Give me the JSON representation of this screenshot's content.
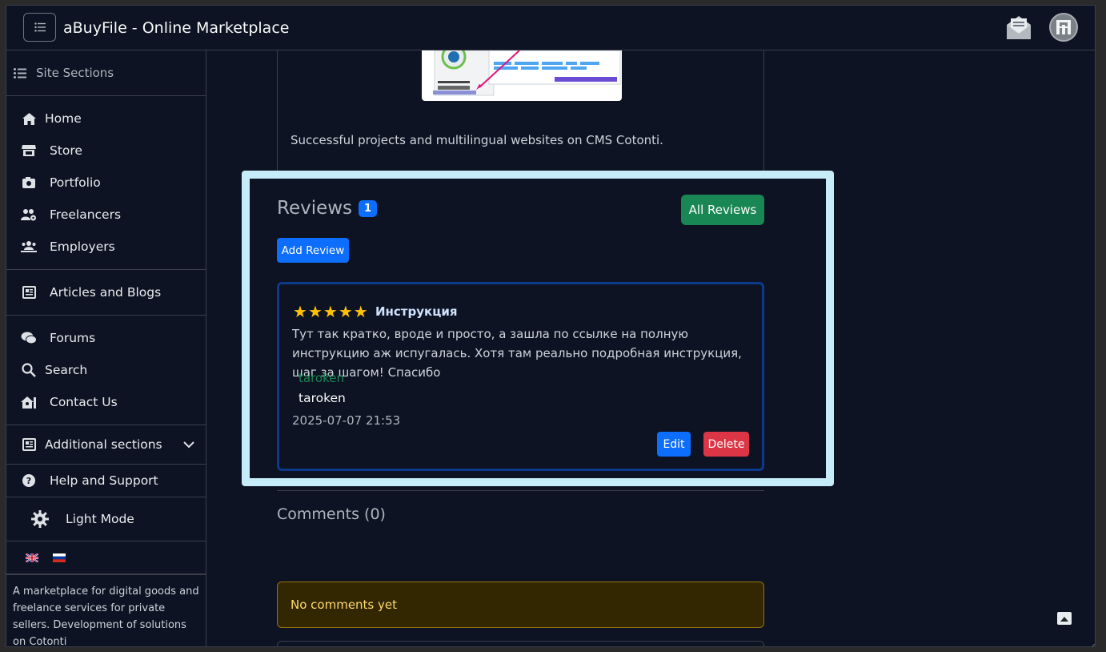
{
  "header": {
    "title": "aBuyFile - Online Marketplace",
    "menu_icon": "list-icon",
    "mail_icon": "envelope-open-icon",
    "avatar_icon": "user-avatar"
  },
  "sidebar": {
    "heading": "Site Sections",
    "group1": [
      {
        "label": "Home",
        "icon": "home-icon"
      },
      {
        "label": "Store",
        "icon": "store-icon"
      },
      {
        "label": "Portfolio",
        "icon": "camera-icon"
      },
      {
        "label": "Freelancers",
        "icon": "users-gear-icon"
      },
      {
        "label": "Employers",
        "icon": "people-icon"
      }
    ],
    "group2": [
      {
        "label": "Articles and Blogs",
        "icon": "newspaper-icon"
      }
    ],
    "group3": [
      {
        "label": "Forums",
        "icon": "comments-icon"
      },
      {
        "label": "Search",
        "icon": "search-icon"
      },
      {
        "label": "Contact Us",
        "icon": "house-user-icon"
      }
    ],
    "additional": "Additional sections",
    "help": "Help and Support",
    "light_mode": "Light Mode",
    "description": "A marketplace for digital goods and freelance services for private sellers. Development of solutions on Cotonti"
  },
  "content": {
    "text": "Successful projects and multilingual websites on CMS Cotonti."
  },
  "reviews": {
    "title": "Reviews",
    "count": "1",
    "all_button": "All Reviews",
    "add_button": "Add Review",
    "items": [
      {
        "rating": 5,
        "title": "Инструкция",
        "body": "Тут так кратко, вроде и просто, а зашла по ссылке на полную инструкцию аж испугалась. Хотя там реально подробная инструкция, шаг за шагом! Спасибо",
        "author_link": "taroken",
        "author_name": "taroken",
        "date": "2025-07-07 21:53",
        "edit": "Edit",
        "delete": "Delete"
      }
    ]
  },
  "comments": {
    "title": "Comments (0)",
    "empty": "No comments yet"
  },
  "colors": {
    "background": "#0d1322",
    "accent_blue": "#0d6efd",
    "accent_green": "#198754",
    "danger": "#dc3545",
    "star": "#ffc107",
    "highlight_border": "#c7ecf9"
  }
}
